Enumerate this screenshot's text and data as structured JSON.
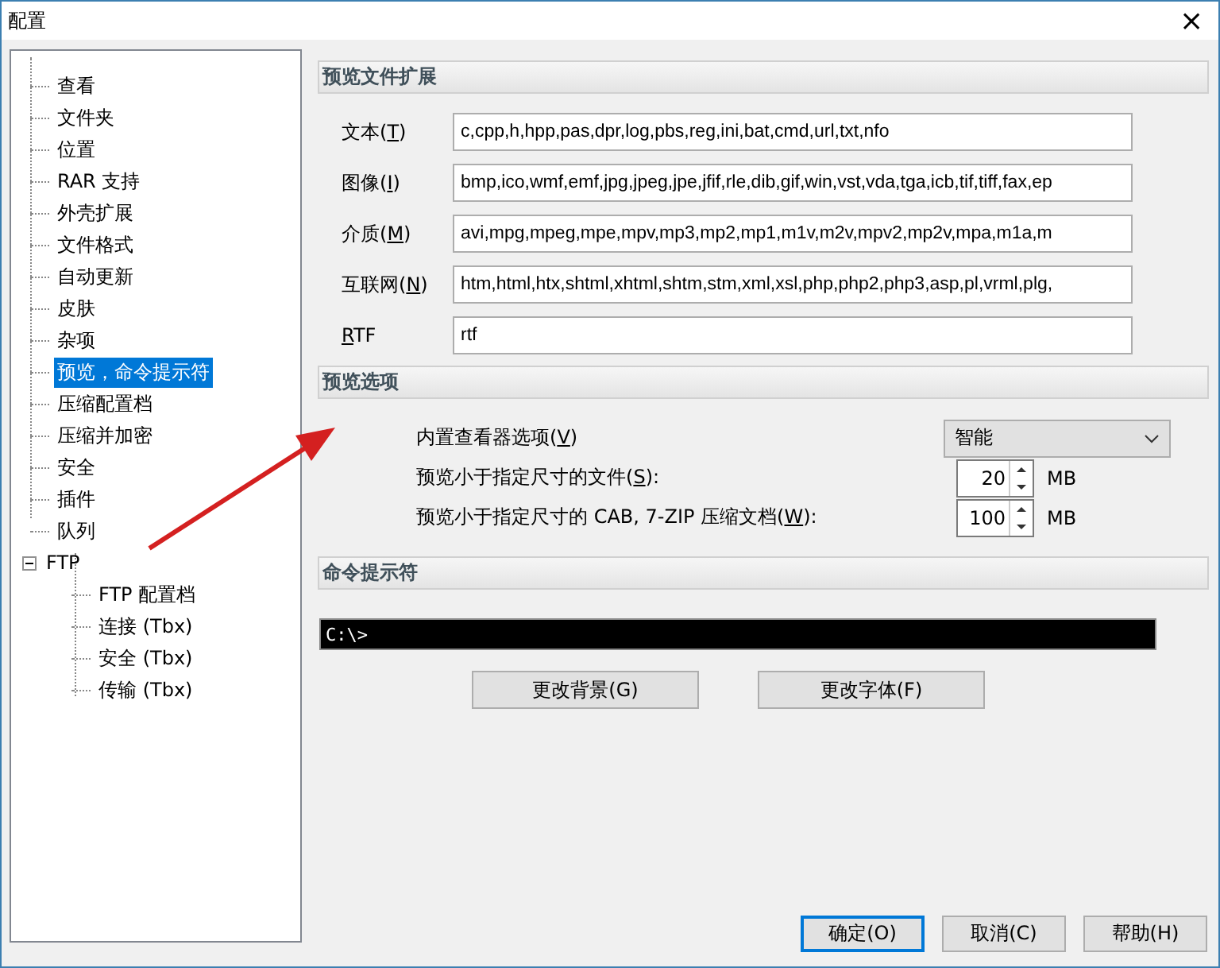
{
  "window": {
    "title": "配置",
    "close": "×"
  },
  "tree": [
    {
      "label": "查看",
      "selected": false
    },
    {
      "label": "文件夹",
      "selected": false
    },
    {
      "label": "位置",
      "selected": false
    },
    {
      "label": "RAR 支持",
      "selected": false
    },
    {
      "label": "外壳扩展",
      "selected": false
    },
    {
      "label": "文件格式",
      "selected": false
    },
    {
      "label": "自动更新",
      "selected": false
    },
    {
      "label": "皮肤",
      "selected": false
    },
    {
      "label": "杂项",
      "selected": false
    },
    {
      "label": "预览，命令提示符",
      "selected": true
    },
    {
      "label": "压缩配置档",
      "selected": false
    },
    {
      "label": "压缩并加密",
      "selected": false
    },
    {
      "label": "安全",
      "selected": false
    },
    {
      "label": "插件",
      "selected": false
    },
    {
      "label": "队列",
      "selected": false
    },
    {
      "label": "FTP",
      "selected": false,
      "expanded": true,
      "children": [
        {
          "label": "FTP 配置档",
          "selected": false
        },
        {
          "label": "连接 (Tbx)",
          "selected": false
        },
        {
          "label": "安全 (Tbx)",
          "selected": false
        },
        {
          "label": "传输 (Tbx)",
          "selected": false
        }
      ]
    }
  ],
  "extensions": {
    "heading": "预览文件扩展",
    "rows": [
      {
        "label_before": "文本(",
        "mnemonic": "T",
        "label_after": ")",
        "value": "c,cpp,h,hpp,pas,dpr,log,pbs,reg,ini,bat,cmd,url,txt,nfo"
      },
      {
        "label_before": "图像(",
        "mnemonic": "I",
        "label_after": ")",
        "value": "bmp,ico,wmf,emf,jpg,jpeg,jpe,jfif,rle,dib,gif,win,vst,vda,tga,icb,tif,tiff,fax,ep"
      },
      {
        "label_before": "介质(",
        "mnemonic": "M",
        "label_after": ")",
        "value": "avi,mpg,mpeg,mpe,mpv,mp3,mp2,mp1,m1v,m2v,mpv2,mp2v,mpa,m1a,m"
      },
      {
        "label_before": "互联网(",
        "mnemonic": "N",
        "label_after": ")",
        "value": "htm,html,htx,shtml,xhtml,shtm,stm,xml,xsl,php,php2,php3,asp,pl,vrml,plg,"
      },
      {
        "label_before": "",
        "mnemonic": "R",
        "label_after": "TF",
        "value": "rtf"
      }
    ]
  },
  "preview_options": {
    "heading": "预览选项",
    "viewer": {
      "label_before": "内置查看器选项(",
      "mnemonic": "V",
      "label_after": ")",
      "value": "智能"
    },
    "spinners": [
      {
        "label_before": "预览小于指定尺寸的文件(",
        "mnemonic": "S",
        "label_after": "):",
        "value": "20",
        "unit": "MB"
      },
      {
        "label_before": "预览小于指定尺寸的 CAB, 7-ZIP 压缩文档(",
        "mnemonic": "W",
        "label_after": "):",
        "value": "100",
        "unit": "MB"
      }
    ]
  },
  "command_prompt": {
    "heading": "命令提示符",
    "prompt": "C:\\>",
    "buttons": [
      "更改背景(G)",
      "更改字体(F)"
    ]
  },
  "footer_buttons": [
    {
      "label": "确定(O)",
      "default": true
    },
    {
      "label": "取消(C)",
      "default": false
    },
    {
      "label": "帮助(H)",
      "default": false
    }
  ]
}
